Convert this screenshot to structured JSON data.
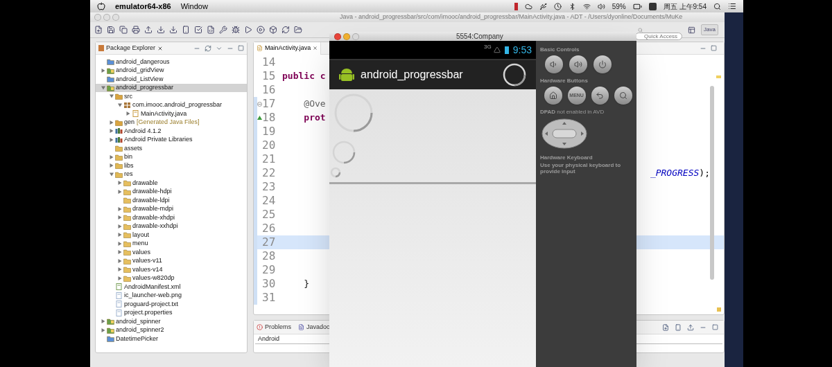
{
  "menubar": {
    "app": "emulator64-x86",
    "menus": [
      "Window"
    ],
    "battery": "59%",
    "clock": "周五 上午9:54"
  },
  "eclipse": {
    "title": "Java - android_progressbar/src/com/imooc/android_progressbar/MainActivity.java - ADT - /Users/dyonline/Documents/MuKe",
    "quick_access": {
      "placeholder": "Quick Access"
    },
    "perspective": "Java"
  },
  "package_explorer": {
    "title": "Package Explorer",
    "tree": [
      {
        "label": "android_dangerous",
        "kind": "closed-project",
        "selected": false
      },
      {
        "label": "android_gridView",
        "kind": "project",
        "expanded": false,
        "selected": false
      },
      {
        "label": "android_ListView",
        "kind": "closed-project",
        "selected": false
      },
      {
        "label": "android_progressbar",
        "kind": "project",
        "expanded": true,
        "selected": true,
        "children": [
          {
            "label": "src",
            "kind": "source-folder",
            "expanded": true,
            "selected": false,
            "children": [
              {
                "label": "com.imooc.android_progressbar",
                "kind": "package",
                "expanded": true,
                "selected": false,
                "children": [
                  {
                    "label": "MainActivity.java",
                    "kind": "java-file",
                    "expanded": false,
                    "selected": false
                  }
                ]
              }
            ]
          },
          {
            "label": "gen",
            "decoration": "[Generated Java Files]",
            "kind": "source-folder",
            "expanded": false,
            "selected": false
          },
          {
            "label": "Android 4.1.2",
            "kind": "library",
            "expanded": false,
            "selected": false
          },
          {
            "label": "Android Private Libraries",
            "kind": "library",
            "expanded": false,
            "selected": false
          },
          {
            "label": "assets",
            "kind": "plain-folder",
            "selected": false
          },
          {
            "label": "bin",
            "kind": "plain-folder",
            "expanded": false,
            "selected": false
          },
          {
            "label": "libs",
            "kind": "plain-folder",
            "expanded": false,
            "selected": false
          },
          {
            "label": "res",
            "kind": "plain-folder",
            "expanded": true,
            "selected": false,
            "children": [
              {
                "label": "drawable",
                "kind": "folder",
                "expanded": false,
                "selected": false
              },
              {
                "label": "drawable-hdpi",
                "kind": "folder",
                "expanded": false,
                "selected": false
              },
              {
                "label": "drawable-ldpi",
                "kind": "folder",
                "selected": false
              },
              {
                "label": "drawable-mdpi",
                "kind": "folder",
                "expanded": false,
                "selected": false
              },
              {
                "label": "drawable-xhdpi",
                "kind": "folder",
                "expanded": false,
                "selected": false
              },
              {
                "label": "drawable-xxhdpi",
                "kind": "folder",
                "expanded": false,
                "selected": false
              },
              {
                "label": "layout",
                "kind": "folder",
                "expanded": false,
                "selected": false
              },
              {
                "label": "menu",
                "kind": "folder",
                "expanded": false,
                "selected": false
              },
              {
                "label": "values",
                "kind": "folder",
                "expanded": false,
                "selected": false
              },
              {
                "label": "values-v11",
                "kind": "folder",
                "expanded": false,
                "selected": false
              },
              {
                "label": "values-v14",
                "kind": "folder",
                "expanded": false,
                "selected": false
              },
              {
                "label": "values-w820dp",
                "kind": "folder",
                "expanded": false,
                "selected": false
              }
            ]
          },
          {
            "label": "AndroidManifest.xml",
            "kind": "xml-file",
            "selected": false
          },
          {
            "label": "ic_launcher-web.png",
            "kind": "file",
            "selected": false
          },
          {
            "label": "proguard-project.txt",
            "kind": "file",
            "selected": false
          },
          {
            "label": "project.properties",
            "kind": "file",
            "selected": false
          }
        ]
      },
      {
        "label": "android_spinner",
        "kind": "project",
        "expanded": false,
        "selected": false
      },
      {
        "label": "android_spinner2",
        "kind": "project",
        "expanded": false,
        "selected": false
      },
      {
        "label": "DatetimePicker",
        "kind": "closed-project",
        "selected": false
      }
    ]
  },
  "editor": {
    "tab": "MainActivity.java",
    "lines": [
      {
        "number": "14",
        "current": false
      },
      {
        "number": "15",
        "text": "public c",
        "kind": "keyword",
        "current": false
      },
      {
        "number": "16",
        "current": false
      },
      {
        "number": "17",
        "text": "    @Ove",
        "kind": "annotation",
        "fold_marker": true,
        "current": false
      },
      {
        "number": "18",
        "text": "    prot",
        "kind": "keyword",
        "override_marker": true,
        "current": false
      },
      {
        "number": "19",
        "current": false
      },
      {
        "number": "20",
        "current": false
      },
      {
        "number": "21",
        "current": false
      },
      {
        "number": "22",
        "tail": "_PROGRESS",
        "tail_end": ");",
        "current": false
      },
      {
        "number": "23",
        "current": false
      },
      {
        "number": "24",
        "current": false
      },
      {
        "number": "25",
        "current": false
      },
      {
        "number": "26",
        "current": false
      },
      {
        "number": "27",
        "current": true
      },
      {
        "number": "28",
        "current": false
      },
      {
        "number": "29",
        "current": false
      },
      {
        "number": "30",
        "text": "    }",
        "kind": "plain",
        "current": false
      },
      {
        "number": "31",
        "current": false
      }
    ]
  },
  "bottom_panel": {
    "tabs": [
      {
        "label": "Problems",
        "kind": "problems"
      },
      {
        "label": "Javadoc",
        "kind": "javadoc"
      }
    ],
    "column_1": "Android"
  },
  "emulator": {
    "title": "5554:Company",
    "network": "3G",
    "clock": "9:53",
    "app_title": "android_progressbar",
    "controls": {
      "basic_label": "Basic Controls",
      "hardware_label": "Hardware Buttons",
      "menu_key": "MENU",
      "dpad_label": "**DPAD** not enabled in AVD",
      "keyboard_label": "Hardware Keyboard",
      "keyboard_note": "Use your physical keyboard to provide input"
    }
  }
}
